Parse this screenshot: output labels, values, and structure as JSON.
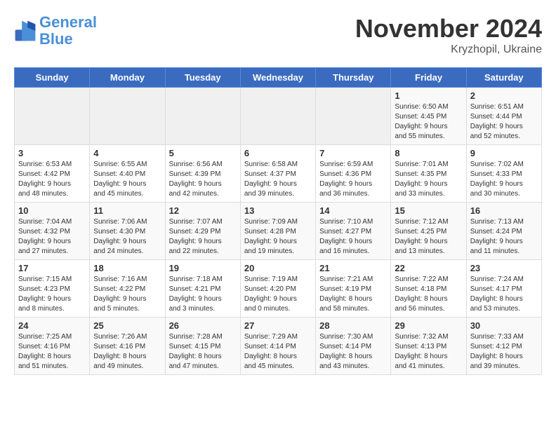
{
  "header": {
    "logo_line1": "General",
    "logo_line2": "Blue",
    "month": "November 2024",
    "location": "Kryzhopil, Ukraine"
  },
  "weekdays": [
    "Sunday",
    "Monday",
    "Tuesday",
    "Wednesday",
    "Thursday",
    "Friday",
    "Saturday"
  ],
  "weeks": [
    [
      {
        "day": "",
        "info": ""
      },
      {
        "day": "",
        "info": ""
      },
      {
        "day": "",
        "info": ""
      },
      {
        "day": "",
        "info": ""
      },
      {
        "day": "",
        "info": ""
      },
      {
        "day": "1",
        "info": "Sunrise: 6:50 AM\nSunset: 4:45 PM\nDaylight: 9 hours\nand 55 minutes."
      },
      {
        "day": "2",
        "info": "Sunrise: 6:51 AM\nSunset: 4:44 PM\nDaylight: 9 hours\nand 52 minutes."
      }
    ],
    [
      {
        "day": "3",
        "info": "Sunrise: 6:53 AM\nSunset: 4:42 PM\nDaylight: 9 hours\nand 48 minutes."
      },
      {
        "day": "4",
        "info": "Sunrise: 6:55 AM\nSunset: 4:40 PM\nDaylight: 9 hours\nand 45 minutes."
      },
      {
        "day": "5",
        "info": "Sunrise: 6:56 AM\nSunset: 4:39 PM\nDaylight: 9 hours\nand 42 minutes."
      },
      {
        "day": "6",
        "info": "Sunrise: 6:58 AM\nSunset: 4:37 PM\nDaylight: 9 hours\nand 39 minutes."
      },
      {
        "day": "7",
        "info": "Sunrise: 6:59 AM\nSunset: 4:36 PM\nDaylight: 9 hours\nand 36 minutes."
      },
      {
        "day": "8",
        "info": "Sunrise: 7:01 AM\nSunset: 4:35 PM\nDaylight: 9 hours\nand 33 minutes."
      },
      {
        "day": "9",
        "info": "Sunrise: 7:02 AM\nSunset: 4:33 PM\nDaylight: 9 hours\nand 30 minutes."
      }
    ],
    [
      {
        "day": "10",
        "info": "Sunrise: 7:04 AM\nSunset: 4:32 PM\nDaylight: 9 hours\nand 27 minutes."
      },
      {
        "day": "11",
        "info": "Sunrise: 7:06 AM\nSunset: 4:30 PM\nDaylight: 9 hours\nand 24 minutes."
      },
      {
        "day": "12",
        "info": "Sunrise: 7:07 AM\nSunset: 4:29 PM\nDaylight: 9 hours\nand 22 minutes."
      },
      {
        "day": "13",
        "info": "Sunrise: 7:09 AM\nSunset: 4:28 PM\nDaylight: 9 hours\nand 19 minutes."
      },
      {
        "day": "14",
        "info": "Sunrise: 7:10 AM\nSunset: 4:27 PM\nDaylight: 9 hours\nand 16 minutes."
      },
      {
        "day": "15",
        "info": "Sunrise: 7:12 AM\nSunset: 4:25 PM\nDaylight: 9 hours\nand 13 minutes."
      },
      {
        "day": "16",
        "info": "Sunrise: 7:13 AM\nSunset: 4:24 PM\nDaylight: 9 hours\nand 11 minutes."
      }
    ],
    [
      {
        "day": "17",
        "info": "Sunrise: 7:15 AM\nSunset: 4:23 PM\nDaylight: 9 hours\nand 8 minutes."
      },
      {
        "day": "18",
        "info": "Sunrise: 7:16 AM\nSunset: 4:22 PM\nDaylight: 9 hours\nand 5 minutes."
      },
      {
        "day": "19",
        "info": "Sunrise: 7:18 AM\nSunset: 4:21 PM\nDaylight: 9 hours\nand 3 minutes."
      },
      {
        "day": "20",
        "info": "Sunrise: 7:19 AM\nSunset: 4:20 PM\nDaylight: 9 hours\nand 0 minutes."
      },
      {
        "day": "21",
        "info": "Sunrise: 7:21 AM\nSunset: 4:19 PM\nDaylight: 8 hours\nand 58 minutes."
      },
      {
        "day": "22",
        "info": "Sunrise: 7:22 AM\nSunset: 4:18 PM\nDaylight: 8 hours\nand 56 minutes."
      },
      {
        "day": "23",
        "info": "Sunrise: 7:24 AM\nSunset: 4:17 PM\nDaylight: 8 hours\nand 53 minutes."
      }
    ],
    [
      {
        "day": "24",
        "info": "Sunrise: 7:25 AM\nSunset: 4:16 PM\nDaylight: 8 hours\nand 51 minutes."
      },
      {
        "day": "25",
        "info": "Sunrise: 7:26 AM\nSunset: 4:16 PM\nDaylight: 8 hours\nand 49 minutes."
      },
      {
        "day": "26",
        "info": "Sunrise: 7:28 AM\nSunset: 4:15 PM\nDaylight: 8 hours\nand 47 minutes."
      },
      {
        "day": "27",
        "info": "Sunrise: 7:29 AM\nSunset: 4:14 PM\nDaylight: 8 hours\nand 45 minutes."
      },
      {
        "day": "28",
        "info": "Sunrise: 7:30 AM\nSunset: 4:14 PM\nDaylight: 8 hours\nand 43 minutes."
      },
      {
        "day": "29",
        "info": "Sunrise: 7:32 AM\nSunset: 4:13 PM\nDaylight: 8 hours\nand 41 minutes."
      },
      {
        "day": "30",
        "info": "Sunrise: 7:33 AM\nSunset: 4:12 PM\nDaylight: 8 hours\nand 39 minutes."
      }
    ]
  ]
}
